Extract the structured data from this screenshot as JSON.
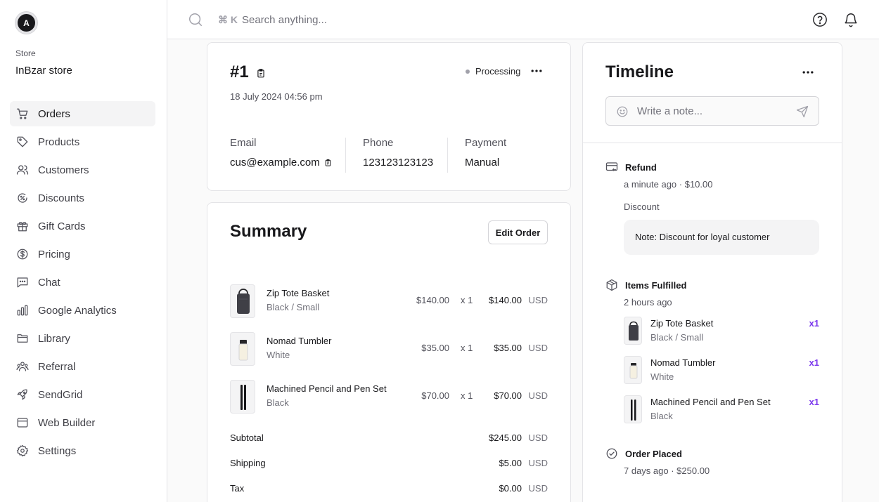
{
  "sidebar": {
    "avatar_letter": "A",
    "store_label": "Store",
    "store_name": "InBzar store",
    "items": [
      {
        "label": "Orders",
        "icon": "cart-icon",
        "active": true
      },
      {
        "label": "Products",
        "icon": "tag-icon"
      },
      {
        "label": "Customers",
        "icon": "users-icon"
      },
      {
        "label": "Discounts",
        "icon": "discount-icon"
      },
      {
        "label": "Gift Cards",
        "icon": "gift-icon"
      },
      {
        "label": "Pricing",
        "icon": "dollar-circle-icon"
      },
      {
        "label": "Chat",
        "icon": "chat-icon"
      },
      {
        "label": "Google Analytics",
        "icon": "bar-chart-icon"
      },
      {
        "label": "Library",
        "icon": "folder-icon"
      },
      {
        "label": "Referral",
        "icon": "referral-icon"
      },
      {
        "label": "SendGrid",
        "icon": "rocket-icon"
      },
      {
        "label": "Web Builder",
        "icon": "browser-icon"
      },
      {
        "label": "Settings",
        "icon": "gear-icon"
      }
    ]
  },
  "topbar": {
    "shortcut": "⌘ K",
    "search_placeholder": "Search anything..."
  },
  "order": {
    "id": "#1",
    "date": "18 July 2024 04:56 pm",
    "status": "Processing",
    "email_label": "Email",
    "email": "cus@example.com",
    "phone_label": "Phone",
    "phone": "123123123123",
    "payment_label": "Payment",
    "payment": "Manual"
  },
  "summary": {
    "title": "Summary",
    "edit_label": "Edit Order",
    "items": [
      {
        "name": "Zip Tote Basket",
        "variant": "Black / Small",
        "price": "$140.00",
        "qty": "x 1",
        "total": "$140.00",
        "currency": "USD"
      },
      {
        "name": "Nomad Tumbler",
        "variant": "White",
        "price": "$35.00",
        "qty": "x 1",
        "total": "$35.00",
        "currency": "USD"
      },
      {
        "name": "Machined Pencil and Pen Set",
        "variant": "Black",
        "price": "$70.00",
        "qty": "x 1",
        "total": "$70.00",
        "currency": "USD"
      }
    ],
    "totals": [
      {
        "label": "Subtotal",
        "value": "$245.00",
        "currency": "USD"
      },
      {
        "label": "Shipping",
        "value": "$5.00",
        "currency": "USD"
      },
      {
        "label": "Tax",
        "value": "$0.00",
        "currency": "USD"
      }
    ]
  },
  "timeline": {
    "title": "Timeline",
    "note_placeholder": "Write a note...",
    "refund": {
      "title": "Refund",
      "meta": "a minute ago · $10.00",
      "reason": "Discount",
      "note": "Note: Discount for loyal customer"
    },
    "fulfilled": {
      "title": "Items Fulfilled",
      "meta": "2 hours ago",
      "items": [
        {
          "name": "Zip Tote Basket",
          "variant": "Black / Small",
          "qty": "x1"
        },
        {
          "name": "Nomad Tumbler",
          "variant": "White",
          "qty": "x1"
        },
        {
          "name": "Machined Pencil and Pen Set",
          "variant": "Black",
          "qty": "x1"
        }
      ]
    },
    "placed": {
      "title": "Order Placed",
      "meta": "7 days ago · $250.00"
    }
  },
  "colors": {
    "accent": "#7c3aed",
    "active_nav": "#f4f4f5",
    "status_dot": "#a1a1aa"
  }
}
